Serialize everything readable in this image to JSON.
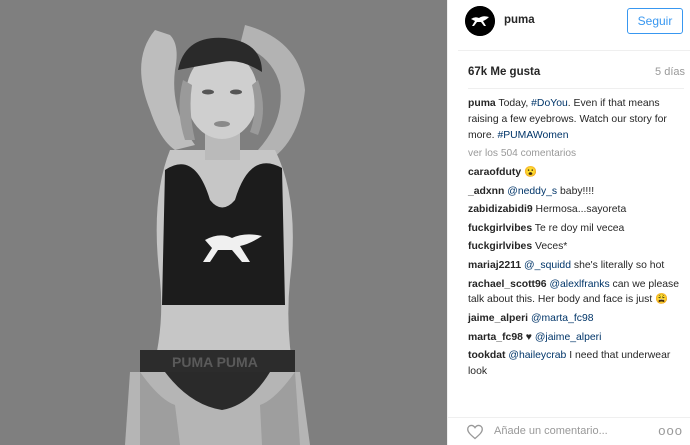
{
  "header": {
    "username": "puma",
    "follow_label": "Seguir"
  },
  "stats": {
    "likes": "67k Me gusta",
    "time": "5 días"
  },
  "caption": {
    "user": "puma",
    "text_1": " Today, ",
    "tag_1": "#DoYou",
    "text_2": ". Even if that means raising a few eyebrows. Watch our story for more. ",
    "tag_2": "#PUMAWomen"
  },
  "view_more": "ver los 504 comentarios",
  "comments": [
    {
      "user": "caraofduty",
      "text": " 😮"
    },
    {
      "user": "_adxnn",
      "mention": "@neddy_s",
      "text": " baby!!!!"
    },
    {
      "user": "zabidizabidi9",
      "text": " Hermosa...sayoreta"
    },
    {
      "user": "fuckgirlvibes",
      "text": " Te re doy mil vecea"
    },
    {
      "user": "fuckgirlvibes",
      "text": " Veces*"
    },
    {
      "user": "mariaj2211",
      "mention": "@_squidd",
      "text": " she's literally so hot"
    },
    {
      "user": "rachael_scott96",
      "mention": "@alexlfranks",
      "text": " can we please talk about this. Her body and face is just 😩"
    },
    {
      "user": "jaime_alperi",
      "mention": "@marta_fc98",
      "text": ""
    },
    {
      "user": "marta_fc98",
      "text": " ♥ ",
      "mention_after": "@jaime_alperi"
    },
    {
      "user": "tookdat",
      "mention": "@haileycrab",
      "text": " I need that underwear look"
    }
  ],
  "footer": {
    "add_comment_placeholder": "Añade un comentario...",
    "more_icon": "ooo"
  },
  "photo": {
    "bra_logo": "PUMA",
    "waistband_text": "PUMA   PUMA",
    "background_color": "#7f7f7f"
  }
}
